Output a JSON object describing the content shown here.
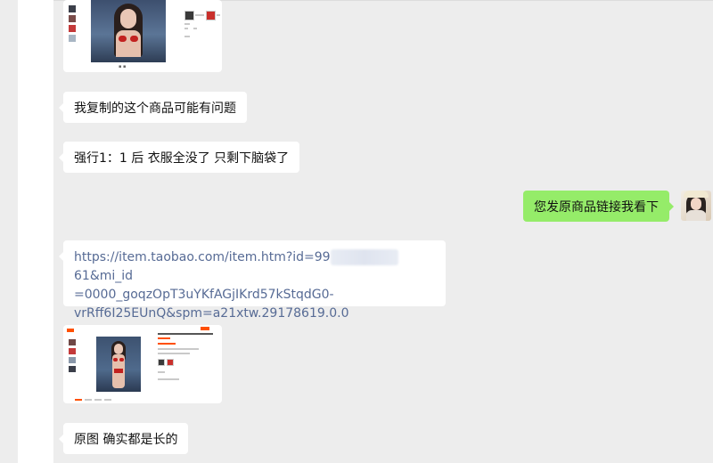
{
  "chat": {
    "messages": [
      {
        "id": 1,
        "side": "left",
        "type": "image",
        "desc": "product-screenshot-1"
      },
      {
        "id": 2,
        "side": "left",
        "type": "text",
        "text": "我复制的这个商品可能有问题"
      },
      {
        "id": 3,
        "side": "left",
        "type": "text",
        "text": "强行1：1 后  衣服全没了 只剩下脑袋了"
      },
      {
        "id": 4,
        "side": "right",
        "type": "text",
        "text": "您发原商品链接我看下"
      },
      {
        "id": 5,
        "side": "left",
        "type": "link",
        "line1_a": "https://item.taobao.com/item.htm?id=99",
        "line1_b": "61&mi_id",
        "line2": "=0000_goqzOpT3uYKfAGjIKrd57kStqdG0-",
        "line3": "vrRff6I25EUnQ&spm=a21xtw.29178619.0.0"
      },
      {
        "id": 6,
        "side": "left",
        "type": "image",
        "desc": "product-screenshot-2"
      },
      {
        "id": 7,
        "side": "left",
        "type": "text",
        "text": "原图 确实都是长的"
      }
    ]
  },
  "colors": {
    "background": "#ededed",
    "bubble_left": "#ffffff",
    "bubble_right": "#95ec69",
    "link": "#576b95",
    "accent": "#ff5000"
  }
}
